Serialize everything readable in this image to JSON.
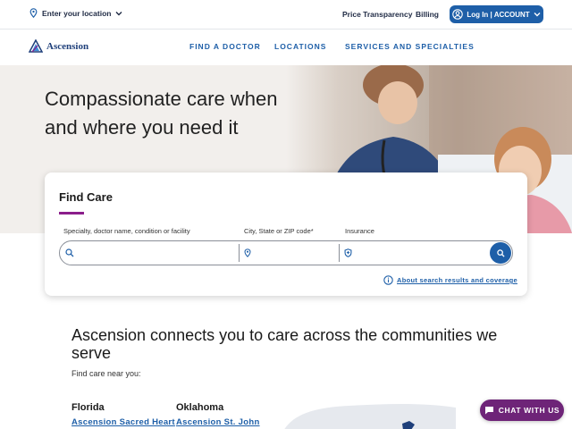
{
  "utility": {
    "location_label": "Enter your location",
    "price_transparency": "Price Transparency",
    "billing": "Billing",
    "login_label": "Log In | ACCOUNT"
  },
  "nav": {
    "logo_text": "Ascension",
    "items": [
      {
        "label": "FIND A DOCTOR"
      },
      {
        "label": "LOCATIONS"
      },
      {
        "label": "SERVICES AND SPECIALTIES"
      }
    ]
  },
  "hero": {
    "title": "Compassionate care when and where you need it"
  },
  "find_care": {
    "title": "Find Care",
    "fields": [
      {
        "label": "Specialty, doctor name, condition or facility",
        "value": "",
        "icon": "search-icon"
      },
      {
        "label": "City, State or ZIP code*",
        "value": "",
        "icon": "location-pin-icon"
      },
      {
        "label": "Insurance",
        "value": "",
        "icon": "shield-icon"
      }
    ],
    "about_link": "About search results and coverage"
  },
  "communities": {
    "title": "Ascension connects you to care across the communities we serve",
    "subtitle": "Find care near you:",
    "states": [
      {
        "name": "Florida",
        "link": "Ascension Sacred Heart"
      },
      {
        "name": "Oklahoma",
        "link": "Ascension St. John"
      }
    ]
  },
  "chat": {
    "label": "CHAT WITH US"
  },
  "colors": {
    "brand_blue": "#1e5fa8",
    "accent_purple": "#8b1e8b",
    "chat_purple": "#6e2478"
  }
}
